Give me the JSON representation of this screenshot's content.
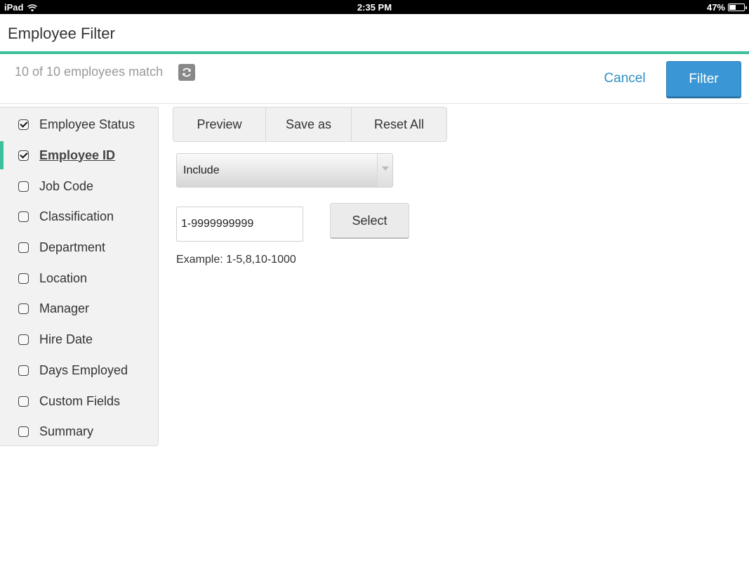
{
  "status_bar": {
    "device": "iPad",
    "time": "2:35 PM",
    "battery_text": "47%",
    "battery_level": 0.47,
    "wifi_icon": "wifi-icon",
    "battery_icon": "battery-icon"
  },
  "header": {
    "title": "Employee Filter"
  },
  "match": {
    "text": "10 of 10 employees match",
    "refresh_icon": "refresh-icon"
  },
  "actions": {
    "cancel_label": "Cancel",
    "filter_label": "Filter"
  },
  "sidebar": {
    "items": [
      {
        "label": "Employee Status",
        "checked": true,
        "active": false
      },
      {
        "label": "Employee ID",
        "checked": true,
        "active": true
      },
      {
        "label": "Job Code",
        "checked": false,
        "active": false
      },
      {
        "label": "Classification",
        "checked": false,
        "active": false
      },
      {
        "label": "Department",
        "checked": false,
        "active": false
      },
      {
        "label": "Location",
        "checked": false,
        "active": false
      },
      {
        "label": "Manager",
        "checked": false,
        "active": false
      },
      {
        "label": "Hire Date",
        "checked": false,
        "active": false
      },
      {
        "label": "Days Employed",
        "checked": false,
        "active": false
      },
      {
        "label": "Custom Fields",
        "checked": false,
        "active": false
      },
      {
        "label": "Summary",
        "checked": false,
        "active": false
      }
    ]
  },
  "toolbar": {
    "preview_label": "Preview",
    "save_as_label": "Save as",
    "reset_all_label": "Reset All"
  },
  "filter_form": {
    "mode_value": "Include",
    "range_value": "1-9999999999",
    "select_label": "Select",
    "example_text": "Example: 1-5,8,10-1000"
  },
  "colors": {
    "accent": "#3dbf9b",
    "primary_button": "#3a96d4",
    "link": "#2e8fc4"
  }
}
